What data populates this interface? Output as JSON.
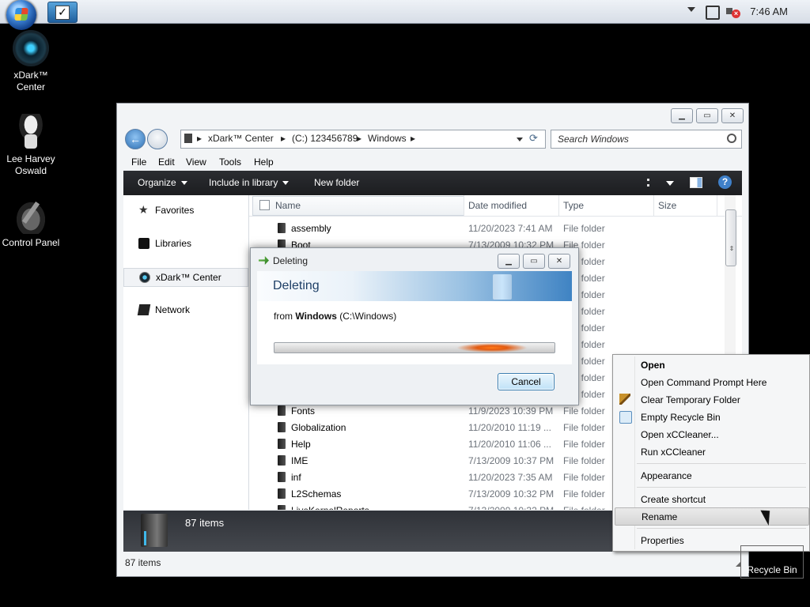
{
  "taskbar": {
    "clock": "7:46 AM"
  },
  "desktop_icons": [
    {
      "label": "xDark™ Center",
      "icon": "xdark-orb-icon"
    },
    {
      "label": "Lee Harvey Oswald",
      "icon": "user-avatar-icon"
    },
    {
      "label": "Control Panel",
      "icon": "control-panel-icon"
    }
  ],
  "explorer": {
    "breadcrumb": [
      "xDark™ Center",
      "(C:) 123456789",
      "Windows"
    ],
    "search_placeholder": "Search Windows",
    "menu": [
      "File",
      "Edit",
      "View",
      "Tools",
      "Help"
    ],
    "commands": {
      "organize": "Organize",
      "include": "Include in library",
      "new_folder": "New folder"
    },
    "nav": [
      "Favorites",
      "Libraries",
      "xDark™ Center",
      "Network"
    ],
    "columns": {
      "name": "Name",
      "date": "Date modified",
      "type": "Type",
      "size": "Size"
    },
    "files": [
      {
        "name": "assembly",
        "date": "11/20/2023 7:41 AM",
        "type": "File folder"
      },
      {
        "name": "Boot",
        "date": "7/13/2009 10:32 PM",
        "type": "File folder"
      },
      {
        "name": "",
        "date": "",
        "type": "File folder"
      },
      {
        "name": "",
        "date": "",
        "type": "File folder"
      },
      {
        "name": "",
        "date": "",
        "type": "File folder"
      },
      {
        "name": "",
        "date": "",
        "type": "File folder"
      },
      {
        "name": "",
        "date": "",
        "type": "File folder"
      },
      {
        "name": "",
        "date": "",
        "type": "File folder"
      },
      {
        "name": "",
        "date": "",
        "type": "File folder"
      },
      {
        "name": "",
        "date": "",
        "type": "File folder"
      },
      {
        "name": "",
        "date": "",
        "type": "File folder"
      },
      {
        "name": "Fonts",
        "date": "11/9/2023 10:39 PM",
        "type": "File folder"
      },
      {
        "name": "Globalization",
        "date": "11/20/2010 11:19 ...",
        "type": "File folder"
      },
      {
        "name": "Help",
        "date": "11/20/2010 11:06 ...",
        "type": "File folder"
      },
      {
        "name": "IME",
        "date": "7/13/2009 10:37 PM",
        "type": "File folder"
      },
      {
        "name": "inf",
        "date": "11/20/2023 7:35 AM",
        "type": "File folder"
      },
      {
        "name": "L2Schemas",
        "date": "7/13/2009 10:32 PM",
        "type": "File folder"
      },
      {
        "name": "LiveKernelReports",
        "date": "7/13/2009 10:32 PM",
        "type": "File folder"
      }
    ],
    "details_count": "87 items",
    "status_count": "87 items"
  },
  "dialog": {
    "title": "Deleting",
    "header": "Deleting",
    "from_prefix": "from",
    "from_folder": "Windows",
    "from_path": "(C:\\Windows)",
    "progress": 0.75,
    "cancel": "Cancel"
  },
  "context_menu": {
    "open": "Open",
    "cmd": "Open Command Prompt Here",
    "clear_temp": "Clear Temporary Folder",
    "empty_bin": "Empty Recycle Bin",
    "open_ccleaner": "Open xCCleaner...",
    "run_ccleaner": "Run xCCleaner",
    "appearance": "Appearance",
    "create_shortcut": "Create shortcut",
    "rename": "Rename",
    "properties": "Properties"
  },
  "recycle_bin": {
    "label": "Recycle Bin"
  }
}
